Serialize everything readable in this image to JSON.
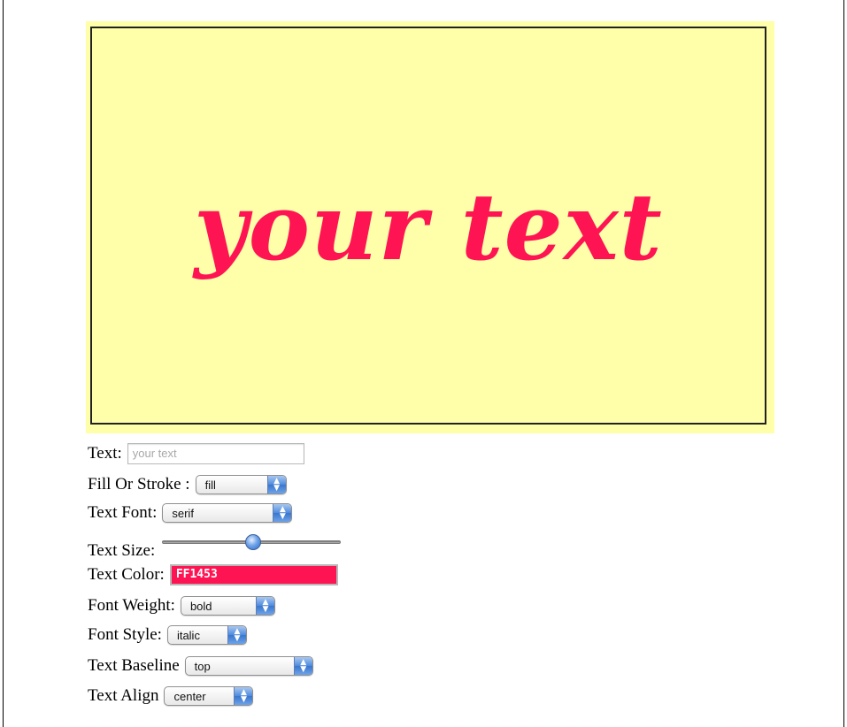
{
  "canvas": {
    "text": "your text",
    "fill_color": "#FF1453",
    "background_color": "#FFFFAA"
  },
  "controls": {
    "text": {
      "label": "Text:",
      "value": "your text"
    },
    "fill_or_stroke": {
      "label": "Fill Or Stroke :",
      "value": "fill"
    },
    "text_font": {
      "label": "Text Font:",
      "value": "serif"
    },
    "text_size": {
      "label": "Text Size:",
      "value_fraction": 0.51
    },
    "text_color": {
      "label": "Text Color:",
      "value": "FF1453",
      "swatch": "#FF1453"
    },
    "font_weight": {
      "label": "Font Weight:",
      "value": "bold"
    },
    "font_style": {
      "label": "Font Style:",
      "value": "italic"
    },
    "text_baseline": {
      "label": "Text Baseline",
      "value": "top"
    },
    "text_align": {
      "label": "Text Align",
      "value": "center"
    }
  }
}
